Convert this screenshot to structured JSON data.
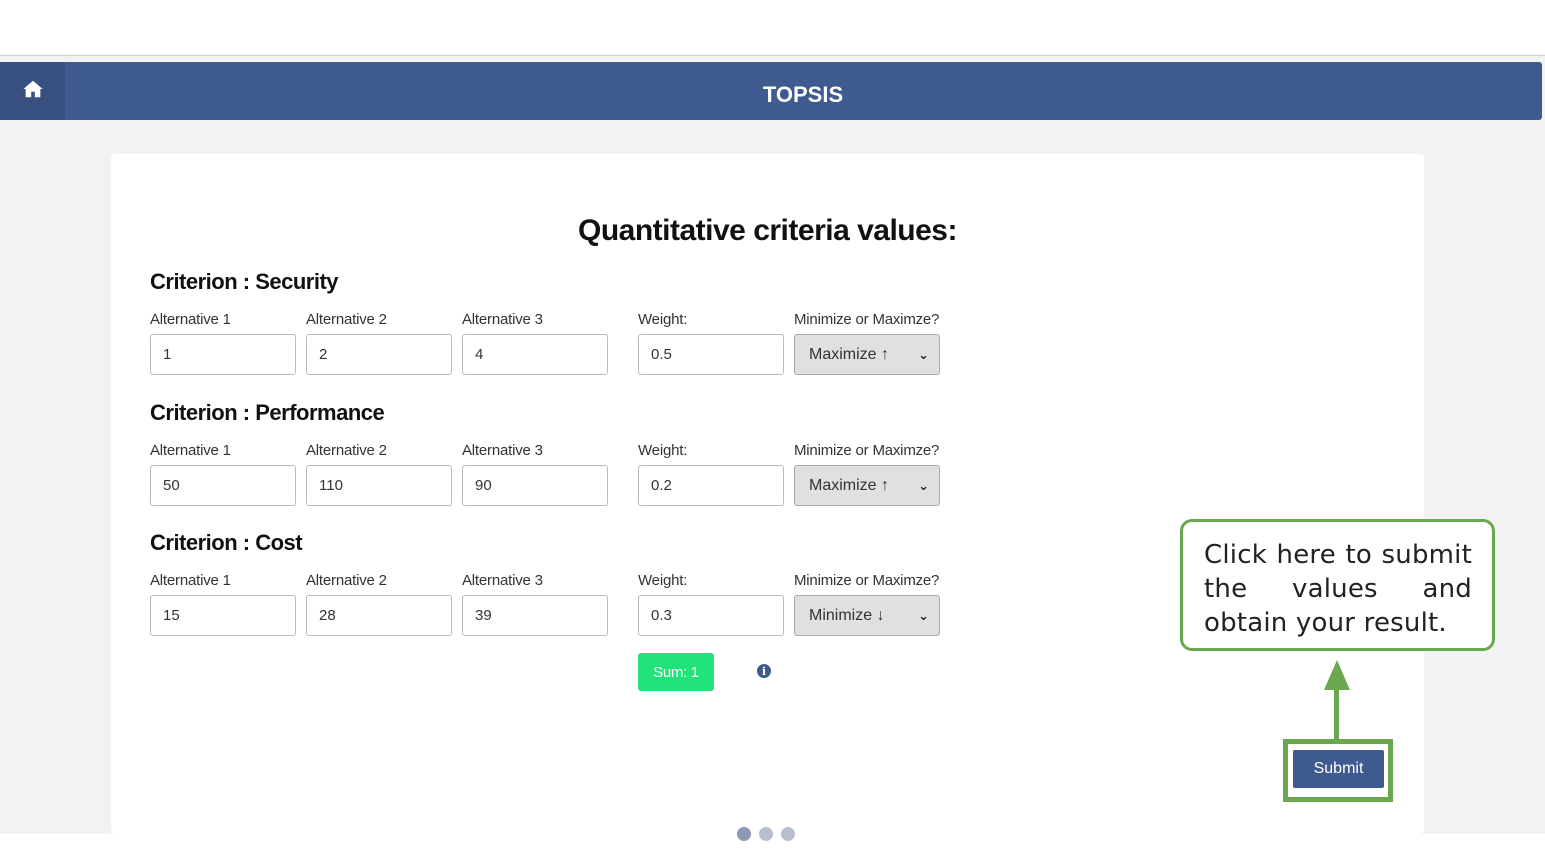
{
  "navbar": {
    "title": "TOPSIS",
    "home_icon": "home-icon"
  },
  "main": {
    "title": "Quantitative criteria values:",
    "criteria": [
      {
        "title": "Criterion : Security",
        "labels": [
          "Alternative 1",
          "Alternative 2",
          "Alternative 3",
          "Weight:",
          "Minimize or Maximze?"
        ],
        "values": [
          "1",
          "2",
          "4"
        ],
        "weight": "0.5",
        "direction": "Maximize ↑"
      },
      {
        "title": "Criterion : Performance",
        "labels": [
          "Alternative 1",
          "Alternative 2",
          "Alternative 3",
          "Weight:",
          "Minimize or Maximze?"
        ],
        "values": [
          "50",
          "110",
          "90"
        ],
        "weight": "0.2",
        "direction": "Maximize ↑"
      },
      {
        "title": "Criterion : Cost",
        "labels": [
          "Alternative 1",
          "Alternative 2",
          "Alternative 3",
          "Weight:",
          "Minimize or Maximze?"
        ],
        "values": [
          "15",
          "28",
          "39"
        ],
        "weight": "0.3",
        "direction": "Minimize ↓"
      }
    ],
    "sum_label": "Sum: 1",
    "info_icon": "info-icon",
    "submit_label": "Submit"
  },
  "annotation": {
    "callout_text": "Click here to submit the values and obtain your result.",
    "color": "#6aa84f"
  },
  "colors": {
    "navbar": "#3f5a8f",
    "sum_badge": "#22e27a"
  }
}
